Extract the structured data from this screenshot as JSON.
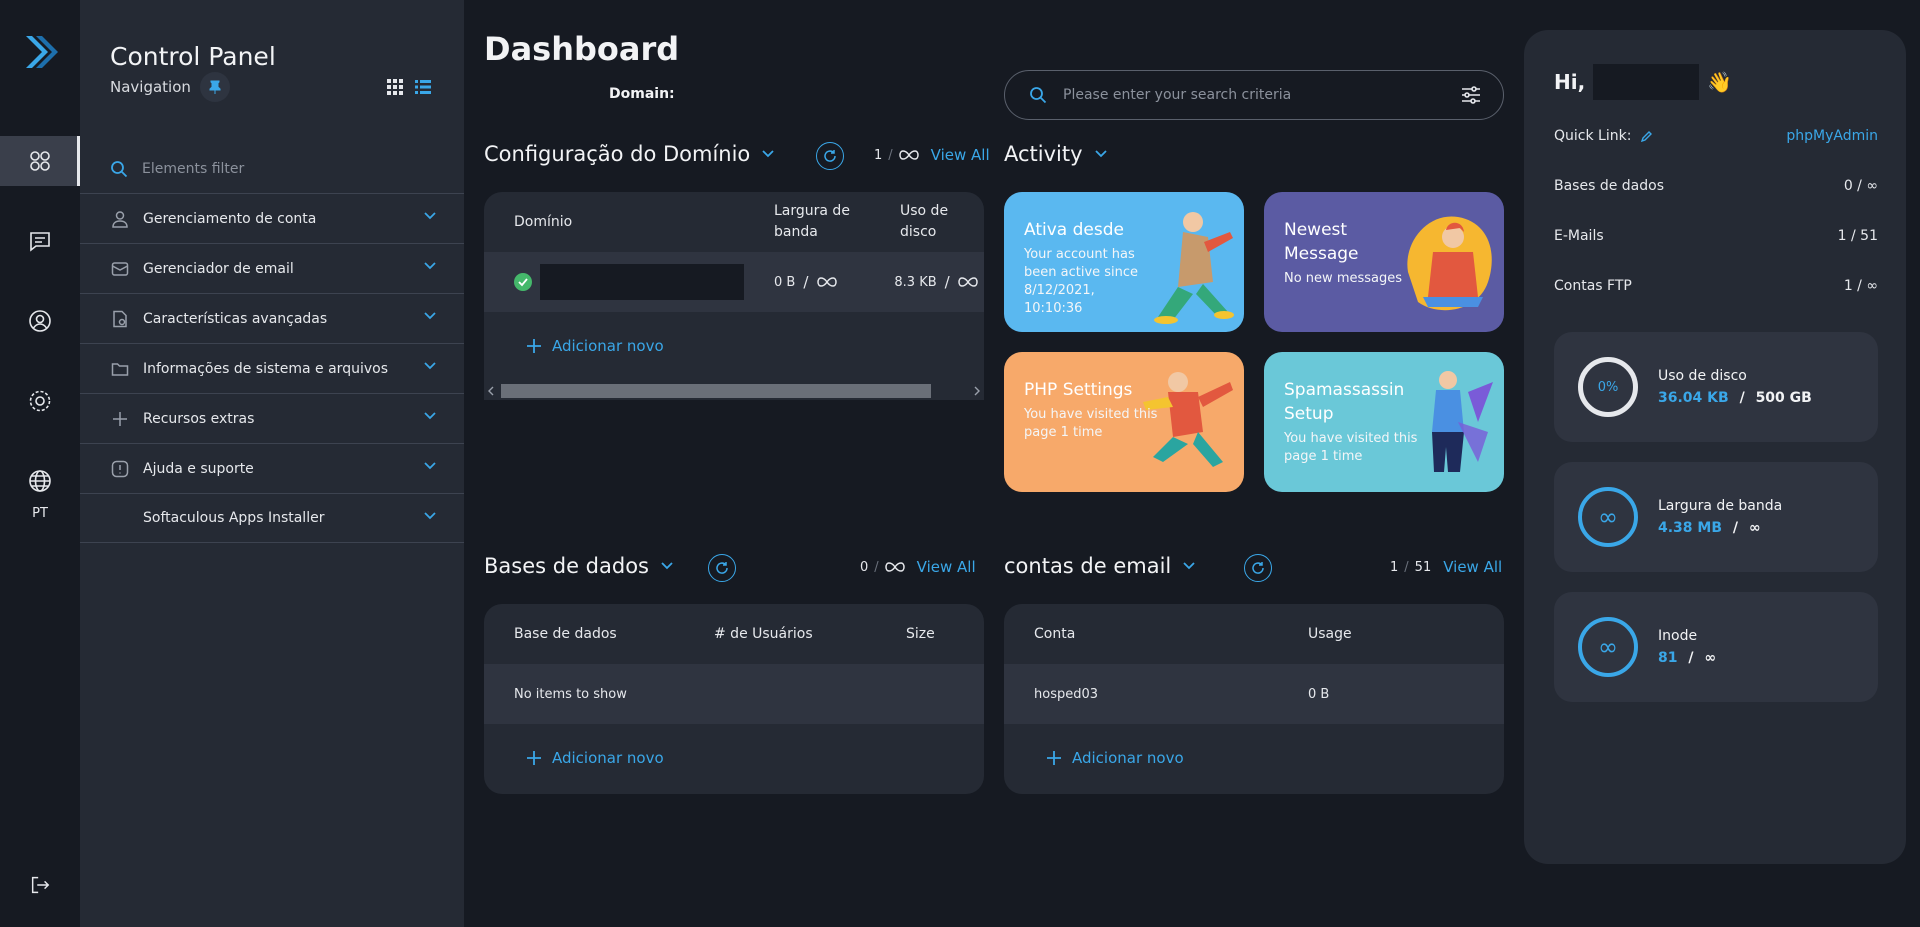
{
  "sidebar": {
    "title": "Control Panel",
    "subtitle": "Navigation",
    "filter_placeholder": "Elements filter",
    "items": [
      {
        "label": "Gerenciamento de conta"
      },
      {
        "label": "Gerenciador de email"
      },
      {
        "label": "Características avançadas"
      },
      {
        "label": "Informações de sistema e arquivos"
      },
      {
        "label": "Recursos extras"
      },
      {
        "label": "Ajuda e suporte"
      },
      {
        "label": "Softaculous Apps Installer"
      }
    ]
  },
  "rail": {
    "lang": "PT"
  },
  "main": {
    "title": "Dashboard",
    "domain_label": "Domain:",
    "search_placeholder": "Please enter your search criteria",
    "domain_section": {
      "title": "Configuração do Domínio",
      "count": "1",
      "sep": "/",
      "view_all": "View All",
      "headers": [
        "Domínio",
        "Largura de banda",
        "Uso de disco"
      ],
      "row": {
        "bandwidth": "0 B",
        "disk": "8.3 KB",
        "slash": "/"
      },
      "add": "Adicionar novo"
    },
    "activity": {
      "title": "Activity",
      "cards": [
        {
          "title": "Ativa desde",
          "desc": "Your account has been active since 8/12/2021, 10:10:36",
          "color": "#5ab8f0"
        },
        {
          "title": "Newest Message",
          "desc": "No new messages",
          "color": "#5b5ba3"
        },
        {
          "title": "PHP Settings",
          "desc": "You have visited this page 1 time",
          "color": "#f7a96a"
        },
        {
          "title": "Spamassassin Setup",
          "desc": "You have visited this page 1 time",
          "color": "#6ac8d8"
        }
      ]
    },
    "db_section": {
      "title": "Bases de dados",
      "count": "0",
      "view_all": "View All",
      "headers": [
        "Base de dados",
        "# de Usuários",
        "Size"
      ],
      "empty": "No items to show",
      "add": "Adicionar novo"
    },
    "email_section": {
      "title": "contas de email",
      "count": "1",
      "sep": "/",
      "total": "51",
      "view_all": "View All",
      "headers": [
        "Conta",
        "Usage"
      ],
      "row": {
        "account": "hosped03",
        "usage": "0 B"
      },
      "add": "Adicionar novo"
    }
  },
  "right": {
    "greeting": "Hi,",
    "wave": "👋",
    "quick_link_label": "Quick Link:",
    "quick_link_value": "phpMyAdmin",
    "stats": [
      {
        "label": "Bases de dados",
        "value": "0 / ∞"
      },
      {
        "label": "E-Mails",
        "value": "1 / 51"
      },
      {
        "label": "Contas FTP",
        "value": "1 / ∞"
      }
    ],
    "usage": [
      {
        "ring": "0%",
        "label": "Uso de disco",
        "used": "36.04 KB",
        "sep": "/",
        "total": "500 GB"
      },
      {
        "ring": "∞",
        "label": "Largura de banda",
        "used": "4.38 MB",
        "sep": "/",
        "total": "∞"
      },
      {
        "ring": "∞",
        "label": "Inode",
        "used": "81",
        "sep": "/",
        "total": "∞"
      }
    ]
  },
  "colors": {
    "accent": "#3aa7e8",
    "success": "#45b86b"
  }
}
